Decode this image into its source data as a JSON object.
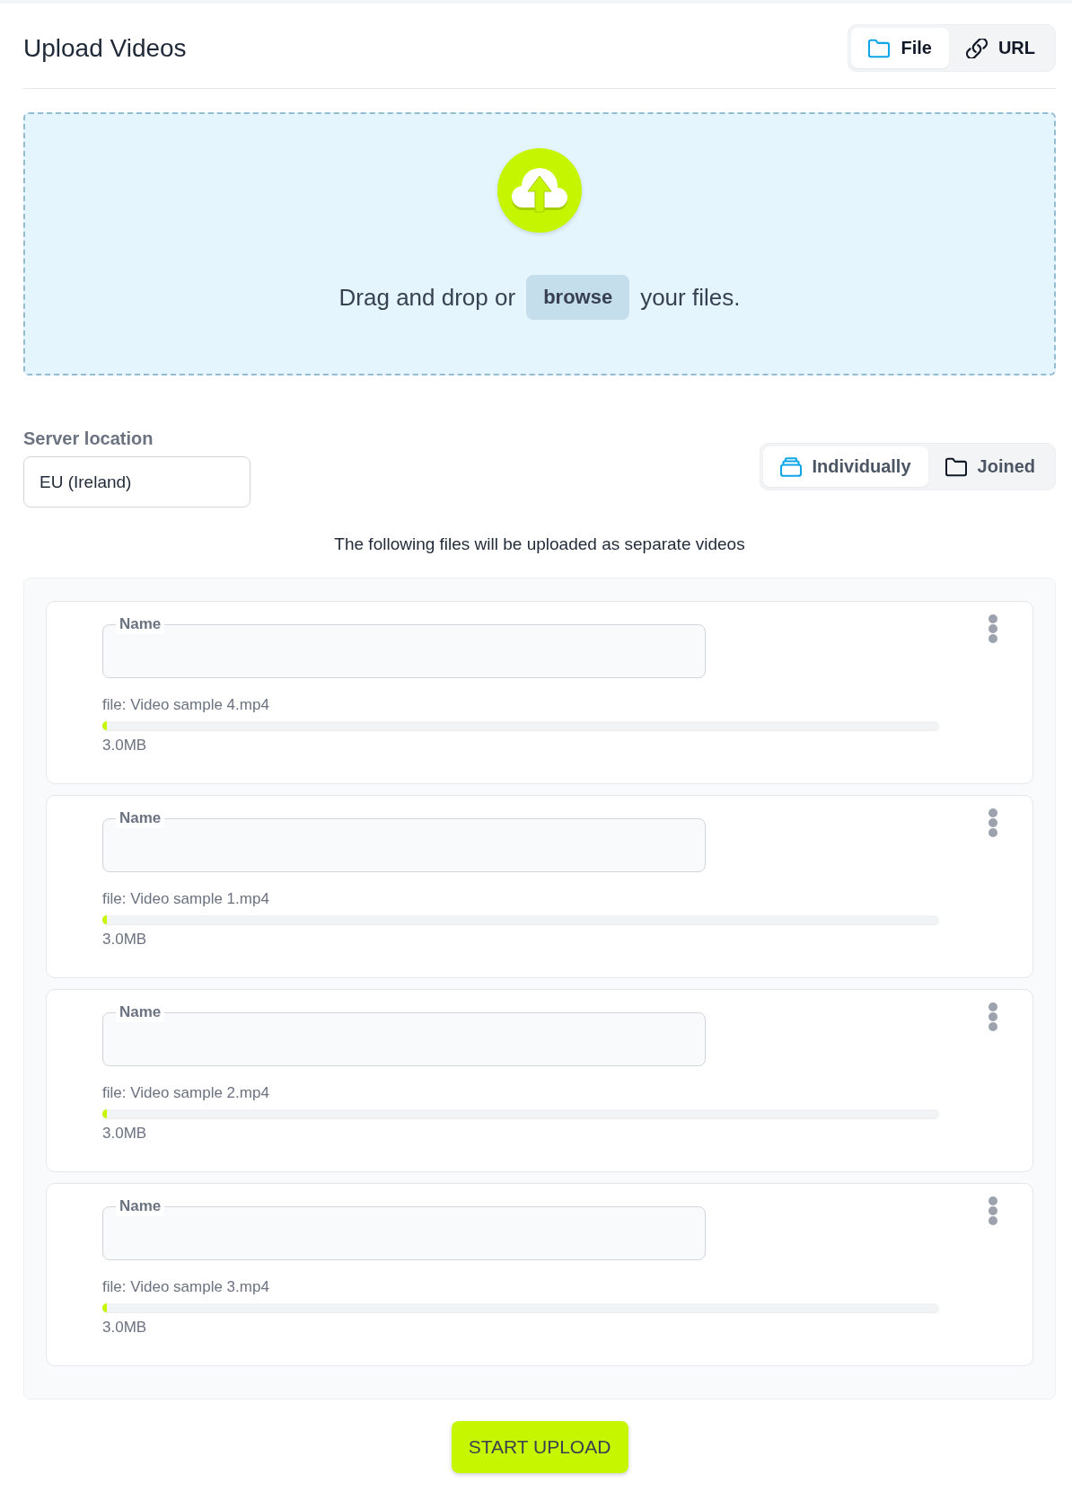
{
  "header": {
    "title": "Upload Videos",
    "source_tabs": [
      {
        "label": "File",
        "selected": true,
        "kind": "folder"
      },
      {
        "label": "URL",
        "selected": false,
        "kind": "link"
      }
    ]
  },
  "dropzone": {
    "text_before": "Drag and drop or",
    "browse_button": "browse",
    "text_after": "your files."
  },
  "server_location": {
    "label": "Server location",
    "value": "EU (Ireland)"
  },
  "mode_tabs": [
    {
      "label": "Individually",
      "selected": true,
      "kind": "stack"
    },
    {
      "label": "Joined",
      "selected": false,
      "kind": "folder"
    }
  ],
  "files_caption": "The following files will be uploaded as separate videos",
  "files": [
    {
      "name_label": "Name",
      "file": "file: Video sample 4.mp4",
      "level": 0.005,
      "size": "3.0MB"
    },
    {
      "name_label": "Name",
      "file": "file: Video sample 1.mp4",
      "level": 0.005,
      "size": "3.0MB"
    },
    {
      "name_label": "Name",
      "file": "file: Video sample 2.mp4",
      "level": 0.005,
      "size": "3.0MB"
    },
    {
      "name_label": "Name",
      "file": "file: Video sample 3.mp4",
      "level": 0.005,
      "size": "3.0MB"
    }
  ],
  "start_button": "START UPLOAD"
}
